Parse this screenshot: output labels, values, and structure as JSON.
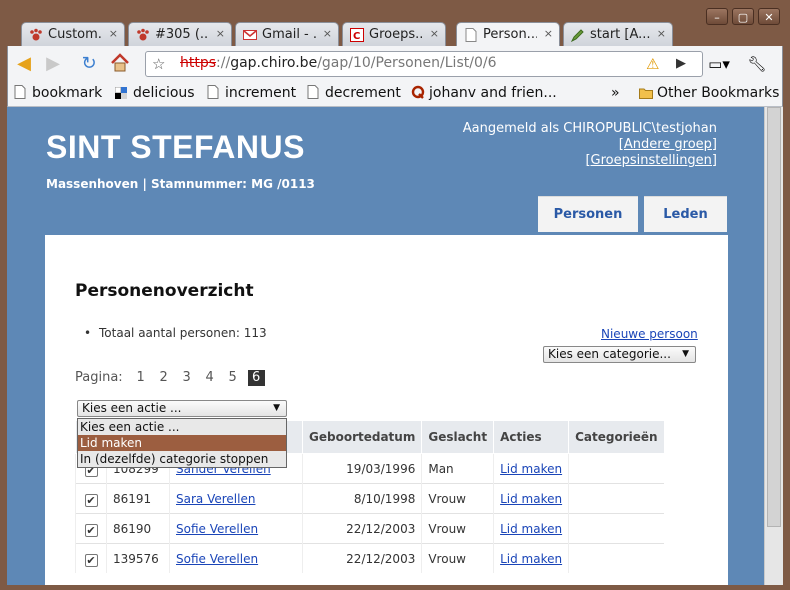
{
  "browser": {
    "tabs": [
      {
        "title": "Custom...",
        "icon": "paw-icon"
      },
      {
        "title": "#305 (...",
        "icon": "paw-icon"
      },
      {
        "title": "Gmail - ...",
        "icon": "gmail-icon"
      },
      {
        "title": "Groeps...",
        "icon": "chiro-icon"
      },
      {
        "title": "Person...",
        "icon": "page-icon",
        "active": true
      },
      {
        "title": "start [A...",
        "icon": "pen-icon"
      }
    ],
    "tab_close": "×",
    "new_tab": "+",
    "url": {
      "scheme": "https",
      "host": "gap.chiro.be",
      "path": "/gap/10/Personen/List/0/6"
    },
    "bookmarks": [
      {
        "label": "bookmark"
      },
      {
        "label": "delicious"
      },
      {
        "label": "increment"
      },
      {
        "label": "decrement"
      },
      {
        "label": "johanv and frien..."
      }
    ],
    "bookmarks_more": "»",
    "other_bookmarks": "Other Bookmarks"
  },
  "header": {
    "title": "SINT STEFANUS",
    "subtitle": "Massenhoven | Stamnummer: MG /0113",
    "login_text": "Aangemeld als CHIROPUBLIC\\testjohan",
    "links": [
      "[Andere groep]",
      "[Groepsinstellingen]"
    ],
    "nav_tabs": [
      "Personen",
      "Leden"
    ]
  },
  "main": {
    "heading": "Personenoverzicht",
    "total": "Totaal aantal personen: 113",
    "new_person": "Nieuwe persoon",
    "category_select": "Kies een categorie...",
    "pagination_label": "Pagina:",
    "pages": [
      "1",
      "2",
      "3",
      "4",
      "5",
      "6"
    ],
    "current_page": "6",
    "action_select": "Kies een actie ...",
    "action_options": [
      "Kies een actie ...",
      "Lid maken",
      "In (dezelfde) categorie stoppen"
    ],
    "selected_action": "Lid maken",
    "table": {
      "columns": [
        "Geboortedatum",
        "Geslacht",
        "Acties",
        "Categorieën"
      ],
      "rows": [
        {
          "id": "108299",
          "name": "Sander Verellen",
          "birth": "19/03/1996",
          "gender": "Man",
          "action": "Lid maken",
          "checked": true
        },
        {
          "id": "86191",
          "name": "Sara Verellen",
          "birth": "8/10/1998",
          "gender": "Vrouw",
          "action": "Lid maken",
          "checked": true
        },
        {
          "id": "86190",
          "name": "Sofie Verellen",
          "birth": "22/12/2003",
          "gender": "Vrouw",
          "action": "Lid maken",
          "checked": true
        },
        {
          "id": "139576",
          "name": "Sofie Verellen",
          "birth": "22/12/2003",
          "gender": "Vrouw",
          "action": "Lid maken",
          "checked": true
        }
      ]
    }
  }
}
